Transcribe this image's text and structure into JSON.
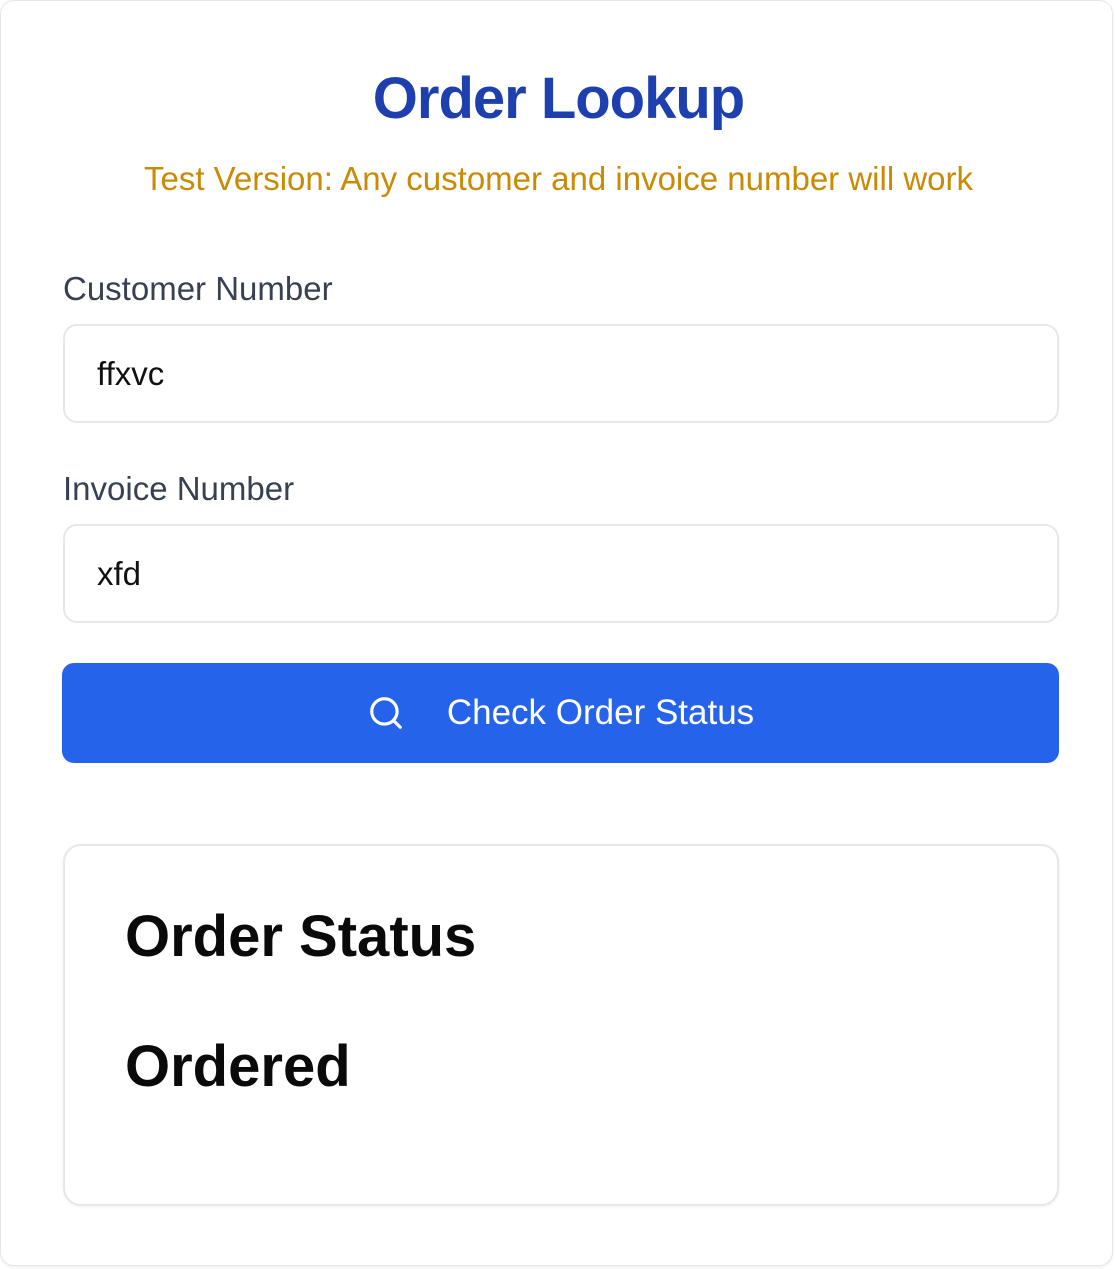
{
  "header": {
    "title": "Order Lookup",
    "subtitle": "Test Version: Any customer and invoice number will work"
  },
  "form": {
    "customer_number": {
      "label": "Customer Number",
      "value": "ffxvc"
    },
    "invoice_number": {
      "label": "Invoice Number",
      "value": "xfd"
    },
    "submit": {
      "label": "Check Order Status",
      "icon": "search-icon"
    }
  },
  "result": {
    "heading": "Order Status",
    "status": "Ordered"
  },
  "colors": {
    "title": "#1e40af",
    "subtitle": "#ca8a04",
    "button": "#2563eb",
    "border": "#e5e7eb",
    "label": "#374151"
  }
}
